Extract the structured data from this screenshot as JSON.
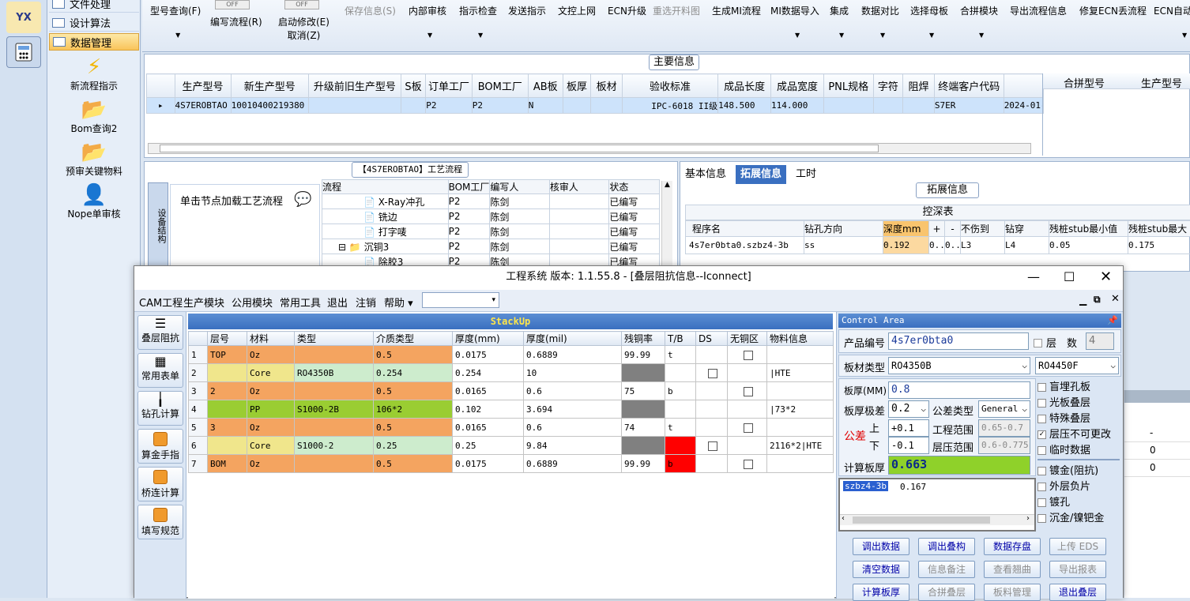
{
  "leftstrip": {
    "logo_text": "YX"
  },
  "nav": {
    "items": [
      "文件处理",
      "设计算法",
      "数据管理"
    ],
    "tools": [
      "新流程指示",
      "Bom查询2",
      "预审关键物料",
      "Nope单审核"
    ]
  },
  "toolbar": {
    "toggle_off": "OFF",
    "items": [
      {
        "label": "型号查询(F)"
      },
      {
        "label": "编写流程(R)"
      },
      {
        "label": "启动修改(E)",
        "sub": "取消(Z)"
      },
      {
        "label": "保存信息(S)"
      },
      {
        "label": "内部审核"
      },
      {
        "label": "指示检查"
      },
      {
        "label": "发送指示"
      },
      {
        "label": "文控上网"
      },
      {
        "label": "ECN升级"
      },
      {
        "label": "重选开料图"
      },
      {
        "label": "生成MI流程"
      },
      {
        "label": "MI数据导入"
      },
      {
        "label": "集成"
      },
      {
        "label": "数据对比"
      },
      {
        "label": "选择母板"
      },
      {
        "label": "合拼模块"
      },
      {
        "label": "导出流程信息"
      },
      {
        "label": "修复ECN丢流程"
      },
      {
        "label": "ECN自动"
      }
    ]
  },
  "main": {
    "title": "主要信息",
    "columns": [
      "生产型号",
      "新生产型号",
      "升级前旧生产型号",
      "S板",
      "订单工厂",
      "BOM工厂",
      "AB板",
      "板厚",
      "板材",
      "验收标准",
      "成品长度",
      "成品宽度",
      "PNL规格",
      "字符",
      "阻焊",
      "终端客户代码"
    ],
    "row": [
      "4S7EROBTAO",
      "10010400219380",
      "",
      "",
      "P2",
      "P2",
      "N",
      "",
      "",
      "IPC-6018 II级",
      "148.500",
      "114.000",
      "",
      "",
      "",
      "S7ER",
      "2024-01-"
    ],
    "right_cols": [
      "合拼型号",
      "生产型号"
    ]
  },
  "process": {
    "title": "【4S7EROBTAO】工艺流程",
    "side_tab": "设备结构",
    "hint": "单击节点加载工艺流程",
    "columns": [
      "流程",
      "BOM工厂",
      "编写人",
      "核审人",
      "状态"
    ],
    "rows": [
      {
        "name": "X-Ray冲孔",
        "bom": "P2",
        "writer": "陈剑",
        "status": "已编写"
      },
      {
        "name": "铣边",
        "bom": "P2",
        "writer": "陈剑",
        "status": "已编写"
      },
      {
        "name": "打字唛",
        "bom": "P2",
        "writer": "陈剑",
        "status": "已编写"
      },
      {
        "name": "沉铜3",
        "bom": "P2",
        "writer": "陈剑",
        "status": "已编写"
      },
      {
        "name": "除胶3",
        "bom": "P2",
        "writer": "陈剑",
        "status": "已编写"
      }
    ]
  },
  "ext": {
    "tabs": [
      "基本信息",
      "拓展信息",
      "工时"
    ],
    "title": "拓展信息",
    "table_title": "控深表",
    "columns": [
      "程序名",
      "钻孔方向",
      "深度mm",
      "+",
      "-",
      "不伤到",
      "钻穿",
      "残桩stub最小值",
      "残桩stub最大"
    ],
    "row": [
      "4s7er0bta0.szbz4-3b",
      "ss",
      "0.192",
      "0..",
      "0..",
      "L3",
      "L4",
      "0.05",
      "0.175"
    ],
    "side_vals": [
      "-",
      "0",
      "0"
    ]
  },
  "dialog": {
    "title": "工程系统  版本: 1.1.55.8 - [叠层阻抗信息--Iconnect]",
    "menus": [
      "CAM工程",
      "生产模块",
      "公用模块",
      "常用工具",
      "退出",
      "注销",
      "帮助"
    ],
    "side_buttons": [
      "叠层阻抗",
      "常用表单",
      "钻孔计算",
      "算金手指",
      "桥连计算",
      "填写规范"
    ],
    "stack_title": "StackUp",
    "columns": [
      "层号",
      "材料",
      "类型",
      "介质类型",
      "厚度(mm)",
      "厚度(mil)",
      "残铜率",
      "T/B",
      "DS",
      "无铜区",
      "物料信息"
    ],
    "rows": [
      {
        "n": "1",
        "layer": "TOP",
        "mat": "Oz",
        "type": "",
        "diel": "0.5",
        "mm": "0.0175",
        "mil": "0.6889",
        "cu": "99.99",
        "tb": "t",
        "ds": "",
        "nocu": true,
        "info": ""
      },
      {
        "n": "2",
        "layer": "",
        "mat": "Core",
        "type": "RO4350B",
        "diel": "0.254",
        "mm": "0.254",
        "mil": "10",
        "cu": "",
        "tb": "",
        "ds": "cb",
        "nocu": false,
        "info": "|HTE"
      },
      {
        "n": "3",
        "layer": "2",
        "mat": "Oz",
        "type": "",
        "diel": "0.5",
        "mm": "0.0165",
        "mil": "0.6",
        "cu": "75",
        "tb": "b",
        "ds": "",
        "nocu": true,
        "info": ""
      },
      {
        "n": "4",
        "layer": "",
        "mat": "PP",
        "type": "S1000-2B",
        "diel": "106*2",
        "mm": "0.102",
        "mil": "3.694",
        "cu": "",
        "tb": "",
        "ds": "",
        "nocu": false,
        "info": "|73*2"
      },
      {
        "n": "5",
        "layer": "3",
        "mat": "Oz",
        "type": "",
        "diel": "0.5",
        "mm": "0.0165",
        "mil": "0.6",
        "cu": "74",
        "tb": "t",
        "ds": "",
        "nocu": true,
        "info": ""
      },
      {
        "n": "6",
        "layer": "",
        "mat": "Core",
        "type": "S1000-2",
        "diel": "0.25",
        "mm": "0.25",
        "mil": "9.84",
        "cu": "",
        "tb": "",
        "ds": "cb",
        "nocu": false,
        "info": "2116*2|HTE"
      },
      {
        "n": "7",
        "layer": "BOM",
        "mat": "Oz",
        "type": "",
        "diel": "0.5",
        "mm": "0.0175",
        "mil": "0.6889",
        "cu": "99.99",
        "tb": "b",
        "ds": "",
        "nocu": true,
        "info": ""
      }
    ]
  },
  "ctrl": {
    "title": "Control Area",
    "product_label": "产品编号",
    "product_value": "4s7er0bta0",
    "layer_label": "层　数",
    "layer_value": "4",
    "board_label": "板材类型",
    "board1": "RO4350B",
    "board2": "RO4450F",
    "thick_label": "板厚(MM)",
    "thick_value": "0.8",
    "tol_label": "板厚极差",
    "tol_value": "0.2",
    "toltype_label": "公差类型",
    "toltype_value": "General",
    "gongcha": "公差",
    "up": "上",
    "down": "下",
    "up_value": "+0.1",
    "down_value": "-0.1",
    "eng_range_label": "工程范围",
    "eng_range": "0.65-0.7",
    "press_range_label": "层压范围",
    "press_range": "0.6-0.775",
    "calc_label": "计算板厚",
    "calc_value": "0.663",
    "list_name": "szbz4-3b",
    "list_value": "0.167",
    "checks": [
      {
        "label": "盲埋孔板",
        "checked": false
      },
      {
        "label": "光板叠层",
        "checked": false
      },
      {
        "label": "特殊叠层",
        "checked": false
      },
      {
        "label": "层压不可更改",
        "checked": true
      },
      {
        "label": "临时数据",
        "checked": false
      },
      {
        "label": "镀金(阻抗)",
        "checked": false
      },
      {
        "label": "外层负片",
        "checked": false
      },
      {
        "label": "镀孔",
        "checked": false
      },
      {
        "label": "沉金/镍钯金",
        "checked": false
      }
    ],
    "buttons": [
      {
        "label": "调出数据",
        "enabled": true
      },
      {
        "label": "调出叠构",
        "enabled": true
      },
      {
        "label": "数据存盘",
        "enabled": true
      },
      {
        "label": "上传 EDS",
        "enabled": false
      },
      {
        "label": "清空数据",
        "enabled": true
      },
      {
        "label": "信息备注",
        "enabled": false
      },
      {
        "label": "查看翘曲",
        "enabled": false
      },
      {
        "label": "导出报表",
        "enabled": false
      },
      {
        "label": "计算板厚",
        "enabled": true
      },
      {
        "label": "合拼叠层",
        "enabled": false
      },
      {
        "label": "板料管理",
        "enabled": false
      },
      {
        "label": "退出叠层",
        "enabled": true
      }
    ]
  },
  "colors": {
    "orange": "#f4a460",
    "yellow": "#f0e68c",
    "green_light": "#cdeccd",
    "green": "#9acd32",
    "gray": "#808080",
    "red": "#ff0000",
    "accent": "#3a6fc0"
  }
}
